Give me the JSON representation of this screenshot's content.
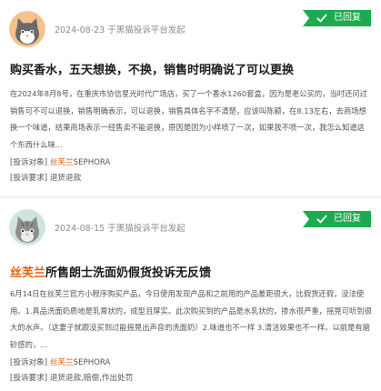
{
  "posts": [
    {
      "date": "2024-08-23",
      "posted_on": "于黑猫投诉平台发起",
      "status": "已回复",
      "title": "购买香水，五天想换，不换，销售时明确说了可以更换",
      "title_highlight": "",
      "excerpt": "在2024年8月8号，在重庆市协信星光时代广场店，买了一个香水1260套盒，因为是老公买的，当时还问过销售可不可以退换，销售明确表示，可以退换，销售具体名字不清楚，应该叫陈颖，在8.13左右，去商场想换一个味道，结果商场表示一经售卖不能退换，原因是因为小样喷了一次，如果我不喷一次，我怎么知道这个东西什么味...",
      "object_label": "[投诉对象]",
      "object_brand": "丝芙兰",
      "object_name": "SEPHORA",
      "demand_label": "[投诉要求]",
      "demand": "退货退款"
    },
    {
      "date": "2024-08-15",
      "posted_on": "于黑猫投诉平台发起",
      "status": "已回复",
      "title": "所售朗士洗面奶假货投诉无反馈",
      "title_highlight": "丝芙兰",
      "excerpt": "6月14日在丝芙兰官方小程序购买产品，今日使用发现产品和之前用的产品差距很大，比假货还假，没法使用。1.真品洗面奶质地是乳膏状的，成型且厚实。此次购买到的产品是水乳状的，掺水很严重，摇晃可听到很大的水声。（这妻子就跟没买到过能摇晃出声音的洗面奶）2.味道也不一样 3.清洁效果也不一样。以前是有磨砂感的，...",
      "object_label": "[投诉对象]",
      "object_brand": "丝芙兰",
      "object_name": "SEPHORA",
      "demand_label": "[投诉要求]",
      "demand": "退货退款,赔偿,作出处罚"
    }
  ],
  "icons": {
    "avatar": "cat-avatar-icon",
    "status_check": "check-icon"
  },
  "colors": {
    "status_green": "#1faa52",
    "brand_orange": "#e8620f",
    "avatar_1_bg": "#f5c28a",
    "avatar_2_bg": "#cfe5dc"
  }
}
